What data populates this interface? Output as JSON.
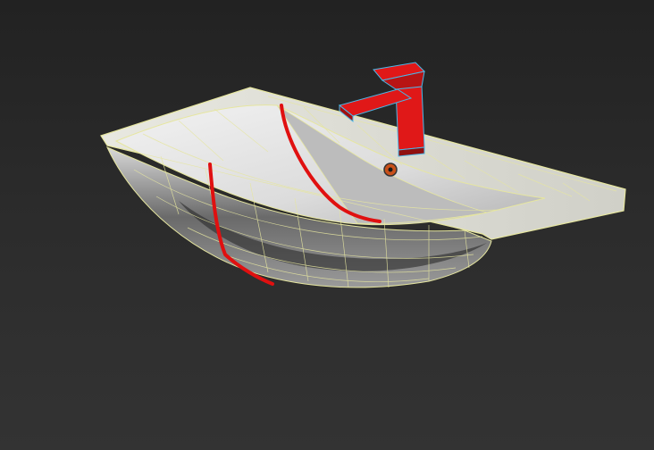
{
  "viewport": {
    "background_top": "#222222",
    "background_bottom": "#333333"
  },
  "model": {
    "wire_color": "#e6e6a0",
    "faucet_color": "#e01818",
    "faucet_edge_color": "#4ab8e8",
    "annotation_color": "#e01010"
  }
}
